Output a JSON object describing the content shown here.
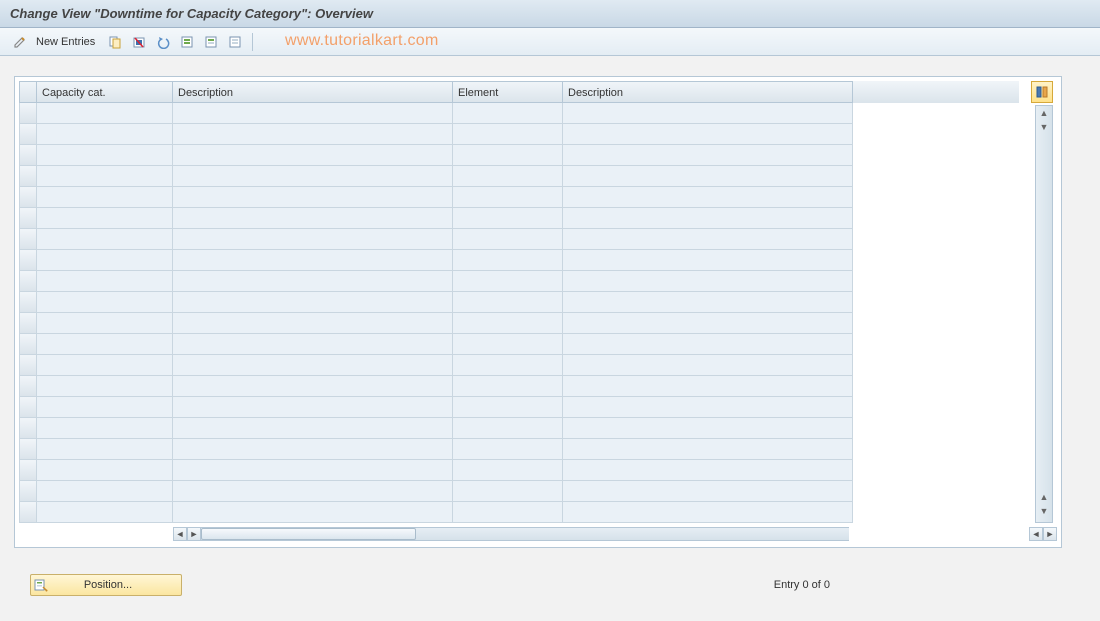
{
  "title": "Change View \"Downtime for Capacity Category\": Overview",
  "toolbar": {
    "new_entries_label": "New Entries"
  },
  "watermark": "www.tutorialkart.com",
  "table": {
    "columns": [
      "Capacity cat.",
      "Description",
      "Element",
      "Description"
    ],
    "row_count": 20
  },
  "footer": {
    "position_label": "Position...",
    "entry_status": "Entry 0 of 0"
  }
}
